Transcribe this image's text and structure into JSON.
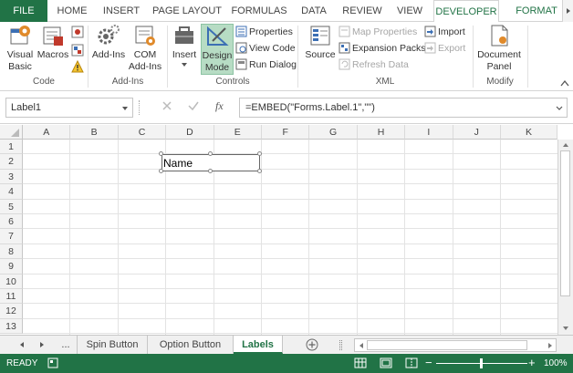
{
  "tabs": [
    "FILE",
    "HOME",
    "INSERT",
    "PAGE LAYOUT",
    "FORMULAS",
    "DATA",
    "REVIEW",
    "VIEW",
    "DEVELOPER",
    "FORMAT"
  ],
  "ribbon": {
    "code": {
      "label": "Code",
      "visual_basic": [
        "Visual",
        "Basic"
      ],
      "macros": "Macros"
    },
    "addins": {
      "label": "Add-Ins",
      "addins": "Add-Ins",
      "com": [
        "COM",
        "Add-Ins"
      ]
    },
    "controls": {
      "label": "Controls",
      "insert": "Insert",
      "design": [
        "Design",
        "Mode"
      ],
      "properties": "Properties",
      "view_code": "View Code",
      "run_dialog": "Run Dialog"
    },
    "xml": {
      "label": "XML",
      "source": "Source",
      "map_properties": "Map Properties",
      "expansion_packs": "Expansion Packs",
      "refresh_data": "Refresh Data",
      "import": "Import",
      "export": "Export"
    },
    "modify": {
      "label": "Modify",
      "document_panel": [
        "Document",
        "Panel"
      ]
    }
  },
  "formula_bar": {
    "name_box": "Label1",
    "formula": "=EMBED(\"Forms.Label.1\",\"\")",
    "fx": "fx"
  },
  "columns": [
    "A",
    "B",
    "C",
    "D",
    "E",
    "F",
    "G",
    "H",
    "I",
    "J",
    "K"
  ],
  "rows": [
    "1",
    "2",
    "3",
    "4",
    "5",
    "6",
    "7",
    "8",
    "9",
    "10",
    "11",
    "12",
    "13"
  ],
  "label_control": {
    "text": "Name"
  },
  "sheets": {
    "ellipsis": "...",
    "tabs": [
      "Spin Button",
      "Option Button",
      "Labels"
    ],
    "active": "Labels",
    "add": "⊕"
  },
  "status": {
    "ready": "READY",
    "zoom": "100%",
    "minus": "−",
    "plus": "+"
  },
  "colors": {
    "accent": "#217346",
    "design_active": "#b7dcc4"
  }
}
